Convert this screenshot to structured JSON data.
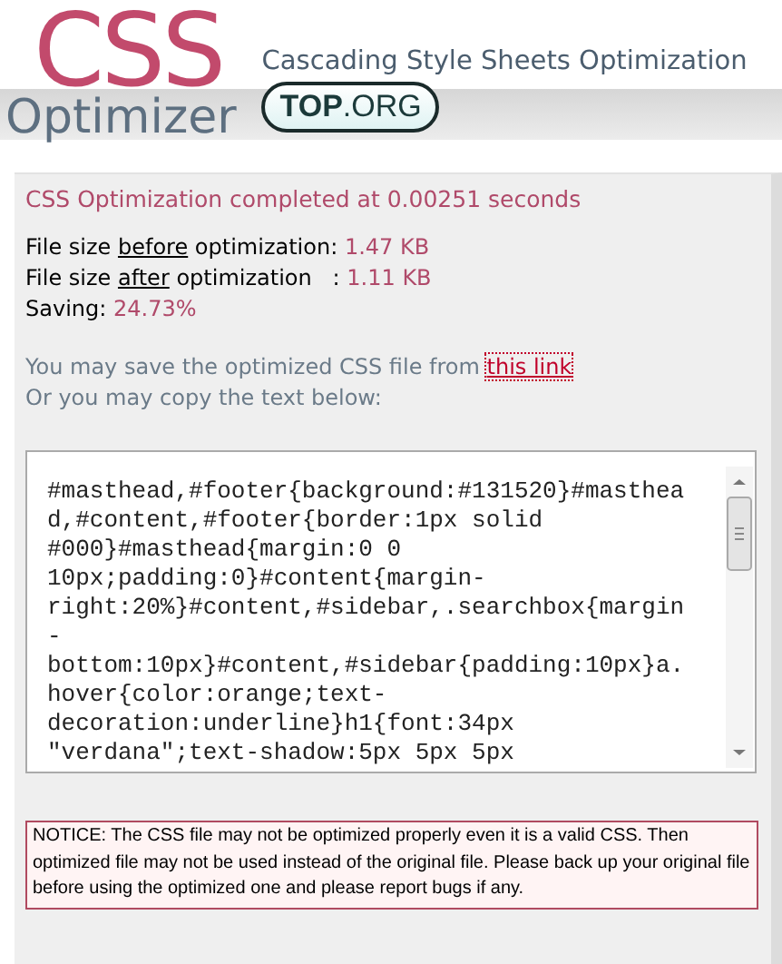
{
  "header": {
    "logo_top": "CSS",
    "logo_bottom": "Optimizer",
    "tagline": "Cascading Style Sheets Optimization",
    "badge": "**TOP**.ORG"
  },
  "result": {
    "status": "CSS Optimization completed at 0.00251 seconds",
    "stats": [
      {
        "prefix": "File size ",
        "underlined": "before",
        "suffix": " optimization: ",
        "value": "1.47 KB"
      },
      {
        "prefix": "File size ",
        "underlined": "after",
        "suffix": " optimization   : ",
        "value": "1.11 KB"
      },
      {
        "prefix": "Saving: ",
        "value": "24.73%"
      }
    ],
    "save_text": "You may save the optimized CSS file from ",
    "save_link": "this link",
    "copy_text": "Or you may copy the text below:",
    "code_lines": [
      "#masthead,#footer{background:#131520}#masthea",
      "d,#content,#footer{border:1px solid",
      "#000}#masthead{margin:0 0",
      "10px;padding:0}#content{margin-",
      "right:20%}#content,#sidebar,.searchbox{margin",
      "-",
      "bottom:10px}#content,#sidebar{padding:10px}a.",
      "hover{color:orange;text-",
      "decoration:underline}h1{font:34px",
      "\"verdana\";text-shadow:5px 5px 5px"
    ],
    "notice": "NOTICE: The CSS file may not be optimized properly even it is a valid CSS. Then optimized file may not be used instead of the original file. Please back up your original file before using the optimized one and please report bugs if any."
  }
}
